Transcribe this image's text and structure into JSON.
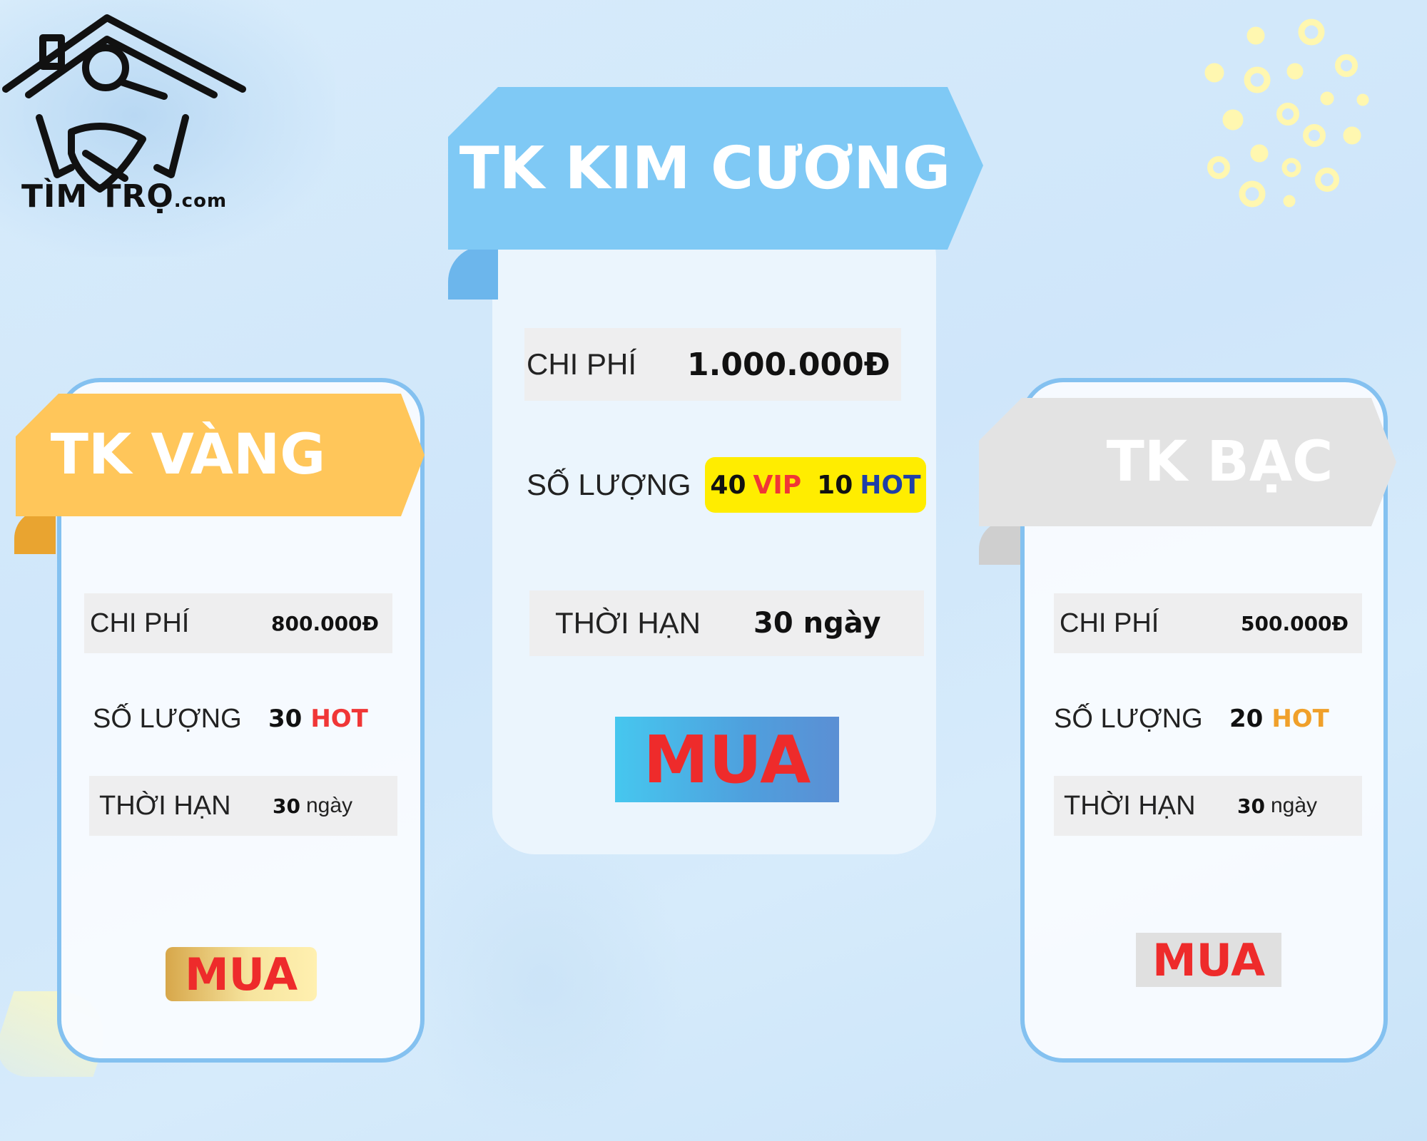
{
  "logo": {
    "brand": "TÌM TRỌ",
    "suffix": ".com"
  },
  "plans": {
    "gold": {
      "title": "TK VÀNG",
      "cost_label": "CHI PHÍ",
      "cost_value": "800.000Đ",
      "qty_label": "SỐ LƯỢNG",
      "qty_number": "30",
      "qty_tag": "HOT",
      "term_label": "THỜI HẠN",
      "term_number": "30",
      "term_unit": "ngày",
      "buy_label": "MUA"
    },
    "diamond": {
      "title": "TK KIM CƯƠNG",
      "cost_label": "CHI PHÍ",
      "cost_value": "1.000.000Đ",
      "qty_label": "SỐ LƯỢNG",
      "qty_vip_number": "40",
      "qty_vip_tag": "VIP",
      "qty_hot_number": "10",
      "qty_hot_tag": "HOT",
      "term_label": "THỜI HẠN",
      "term_value": "30 ngày",
      "buy_label": "MUA"
    },
    "silver": {
      "title": "TK BẠC",
      "cost_label": "CHI PHÍ",
      "cost_value": "500.000Đ",
      "qty_label": "SỐ LƯỢNG",
      "qty_number": "20",
      "qty_tag": "HOT",
      "term_label": "THỜI HẠN",
      "term_number": "30",
      "term_unit": "ngày",
      "buy_label": "MUA"
    }
  },
  "colors": {
    "gold_ribbon": "#ffc65a",
    "diamond_ribbon": "#7fc9f5",
    "silver_ribbon": "#e3e3e3",
    "card_border": "#84c1f0",
    "buy_text": "#ee2b2b",
    "qty_badge": "#ffed00"
  }
}
